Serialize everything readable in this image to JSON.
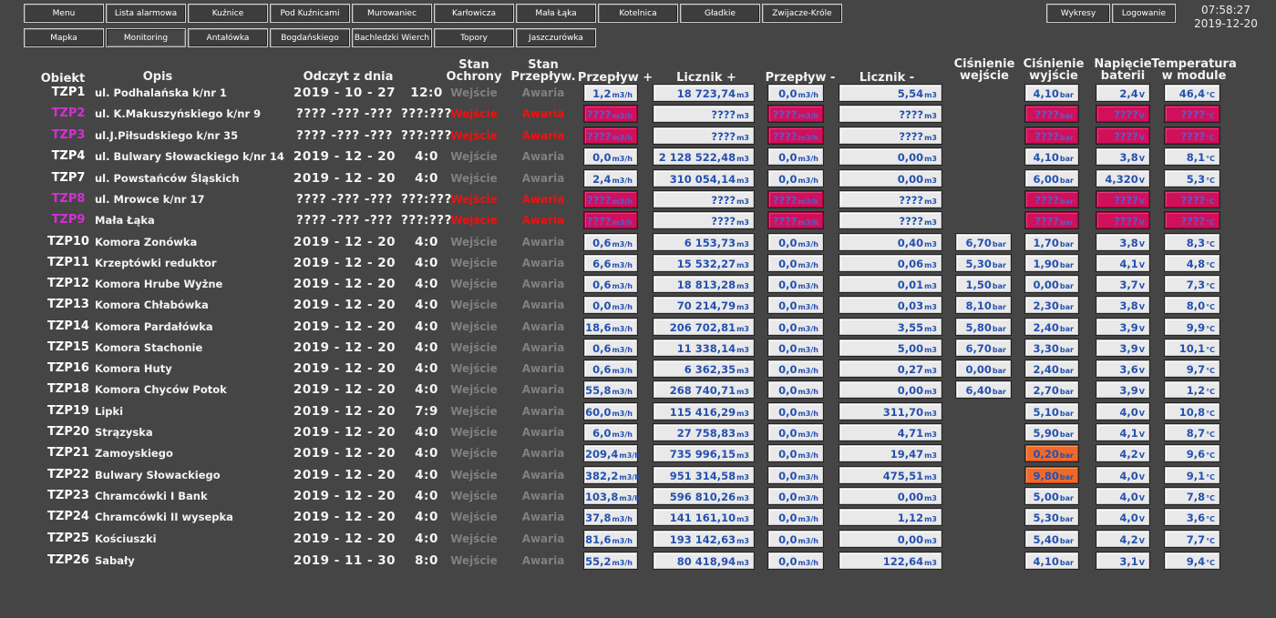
{
  "nav": {
    "row1": [
      "Menu",
      "Lista alarmowa",
      "Kuźnice",
      "Pod Kuźnicami",
      "Murowaniec",
      "Karłowicza",
      "Mała Łąka",
      "Kotelnica",
      "Gładkie",
      "Zwijacze-Króle"
    ],
    "row2": [
      "Mapka",
      "Monitoring",
      "Antałówka",
      "Bogdańskiego",
      "Bachledzki Wierch",
      "Topory",
      "Jaszczurówka"
    ],
    "active": "Monitoring"
  },
  "right_buttons": [
    "Wykresy",
    "Logowanie"
  ],
  "clock": {
    "time": "07:58:27",
    "date": "2019-12-20"
  },
  "headers": {
    "obiekt": "Obiekt",
    "opis": "Opis",
    "odczyt": "Odczyt z dnia",
    "stan_ochrony_1": "Stan",
    "stan_ochrony_2": "Ochrony",
    "stan_przeplyw_1": "Stan",
    "stan_przeplyw_2": "Przepływ.",
    "przeplyw_plus": "Przepływ +",
    "licznik_plus": "Licznik +",
    "przeplyw_minus": "Przepływ -",
    "licznik_minus": "Licznik -",
    "cisn_wej_1": "Ciśnienie",
    "cisn_wej_2": "wejście",
    "cisn_wyj_1": "Ciśnienie",
    "cisn_wyj_2": "wyjście",
    "napiecie_1": "Napięcie",
    "napiecie_2": "baterii",
    "temp_1": "Temperatura",
    "temp_2": "w module"
  },
  "labels": {
    "wejscie": "Wejście",
    "awaria": "Awaria"
  },
  "units": {
    "flow": "m3/h",
    "vol": "m3",
    "bar": "bar",
    "volt": "V",
    "temp": "°C"
  },
  "colors": {
    "alarm_box": "#d0105a",
    "warn_box": "#ef6a2a",
    "alarm_text": "#f01010",
    "alarm_id": "#d430d4",
    "value": "#2451b0"
  },
  "rows": [
    {
      "id": "TZP1",
      "desc": "ul. Podhalańska k/nr 1",
      "date": "2019 - 10 - 27",
      "time": "12:0",
      "alarm": false,
      "f1": "1,2",
      "l1": "18 723,74",
      "f2": "0,0",
      "l2": "5,54",
      "pin": "",
      "pout": "4,10",
      "bat": "2,4",
      "tmp": "46,4"
    },
    {
      "id": "TZP2",
      "desc": "ul. K.Makuszyńskiego k/nr 9",
      "date": "???? -??? -???",
      "time": "???:???",
      "alarm": true,
      "f1": "????",
      "l1": "????",
      "f2": "????",
      "l2": "????",
      "pin": "",
      "pout": "????",
      "bat": "????",
      "tmp": "????"
    },
    {
      "id": "TZP3",
      "desc": "ul.J.Piłsudskiego k/nr 35",
      "date": "???? -??? -???",
      "time": "???:???",
      "alarm": true,
      "f1": "????",
      "l1": "????",
      "f2": "????",
      "l2": "????",
      "pin": "",
      "pout": "????",
      "bat": "????",
      "tmp": "????"
    },
    {
      "id": "TZP4",
      "desc": "ul. Bulwary Słowackiego k/nr 14",
      "date": "2019 - 12 - 20",
      "time": "4:0",
      "alarm": false,
      "f1": "0,0",
      "l1": "2 128 522,48",
      "f2": "0,0",
      "l2": "0,00",
      "pin": "",
      "pout": "4,10",
      "bat": "3,8",
      "tmp": "8,1"
    },
    {
      "id": "TZP7",
      "desc": "ul. Powstańców Śląskich",
      "date": "2019 - 12 - 20",
      "time": "4:0",
      "alarm": false,
      "f1": "2,4",
      "l1": "310 054,14",
      "f2": "0,0",
      "l2": "0,00",
      "pin": "",
      "pout": "6,00",
      "bat": "4,320",
      "tmp": "5,3"
    },
    {
      "id": "TZP8",
      "desc": "ul. Mrowce k/nr 17",
      "date": "???? -??? -???",
      "time": "???:???",
      "alarm": true,
      "f1": "????",
      "l1": "????",
      "f2": "????",
      "l2": "????",
      "pin": "",
      "pout": "????",
      "bat": "????",
      "tmp": "????"
    },
    {
      "id": "TZP9",
      "desc": "Mała Łąka",
      "date": "???? -??? -???",
      "time": "???:???",
      "alarm": true,
      "f1": "????",
      "l1": "????",
      "f2": "????",
      "l2": "????",
      "pin": "",
      "pout": "????",
      "bat": "????",
      "tmp": "????"
    },
    {
      "id": "TZP10",
      "desc": "Komora Zonówka",
      "date": "2019 - 12 - 20",
      "time": "4:0",
      "alarm": false,
      "f1": "0,6",
      "l1": "6 153,73",
      "f2": "0,0",
      "l2": "0,40",
      "pin": "6,70",
      "pout": "1,70",
      "bat": "3,8",
      "tmp": "8,3"
    },
    {
      "id": "TZP11",
      "desc": "Krzeptówki reduktor",
      "date": "2019 - 12 - 20",
      "time": "4:0",
      "alarm": false,
      "f1": "6,6",
      "l1": "15 532,27",
      "f2": "0,0",
      "l2": "0,06",
      "pin": "5,30",
      "pout": "1,90",
      "bat": "4,1",
      "tmp": "4,8"
    },
    {
      "id": "TZP12",
      "desc": "Komora Hrube Wyżne",
      "date": "2019 - 12 - 20",
      "time": "4:0",
      "alarm": false,
      "f1": "0,6",
      "l1": "18 813,28",
      "f2": "0,0",
      "l2": "0,01",
      "pin": "1,50",
      "pout": "0,00",
      "bat": "3,7",
      "tmp": "7,3"
    },
    {
      "id": "TZP13",
      "desc": "Komora Chłabówka",
      "date": "2019 - 12 - 20",
      "time": "4:0",
      "alarm": false,
      "f1": "0,0",
      "l1": "70 214,79",
      "f2": "0,0",
      "l2": "0,03",
      "pin": "8,10",
      "pout": "2,30",
      "bat": "3,8",
      "tmp": "8,0"
    },
    {
      "id": "TZP14",
      "desc": "Komora Pardałówka",
      "date": "2019 - 12 - 20",
      "time": "4:0",
      "alarm": false,
      "f1": "18,6",
      "l1": "206 702,81",
      "f2": "0,0",
      "l2": "3,55",
      "pin": "5,80",
      "pout": "2,40",
      "bat": "3,9",
      "tmp": "9,9"
    },
    {
      "id": "TZP15",
      "desc": "Komora Stachonie",
      "date": "2019 - 12 - 20",
      "time": "4:0",
      "alarm": false,
      "f1": "0,6",
      "l1": "11 338,14",
      "f2": "0,0",
      "l2": "5,00",
      "pin": "6,70",
      "pout": "3,30",
      "bat": "3,9",
      "tmp": "10,1"
    },
    {
      "id": "TZP16",
      "desc": "Komora Huty",
      "date": "2019 - 12 - 20",
      "time": "4:0",
      "alarm": false,
      "f1": "0,6",
      "l1": "6 362,35",
      "f2": "0,0",
      "l2": "0,27",
      "pin": "0,00",
      "pout": "2,40",
      "bat": "3,6",
      "tmp": "9,7"
    },
    {
      "id": "TZP18",
      "desc": "Komora Chyców Potok",
      "date": "2019 - 12 - 20",
      "time": "4:0",
      "alarm": false,
      "f1": "55,8",
      "l1": "268 740,71",
      "f2": "0,0",
      "l2": "0,00",
      "pin": "6,40",
      "pout": "2,70",
      "bat": "3,9",
      "tmp": "1,2"
    },
    {
      "id": "TZP19",
      "desc": "Lipki",
      "date": "2019 - 12 - 20",
      "time": "7:9",
      "alarm": false,
      "f1": "60,0",
      "l1": "115 416,29",
      "f2": "0,0",
      "l2": "311,70",
      "pin": "",
      "pout": "5,10",
      "bat": "4,0",
      "tmp": "10,8"
    },
    {
      "id": "TZP20",
      "desc": "Strązyska",
      "date": "2019 - 12 - 20",
      "time": "4:0",
      "alarm": false,
      "f1": "6,0",
      "l1": "27 758,83",
      "f2": "0,0",
      "l2": "4,71",
      "pin": "",
      "pout": "5,90",
      "bat": "4,1",
      "tmp": "8,7"
    },
    {
      "id": "TZP21",
      "desc": "Zamoyskiego",
      "date": "2019 - 12 - 20",
      "time": "4:0",
      "alarm": false,
      "f1": "209,4",
      "l1": "735 996,15",
      "f2": "0,0",
      "l2": "19,47",
      "pin": "",
      "pout": "0,20",
      "pout_warn": true,
      "bat": "4,2",
      "tmp": "9,6"
    },
    {
      "id": "TZP22",
      "desc": "Bulwary Słowackiego",
      "date": "2019 - 12 - 20",
      "time": "4:0",
      "alarm": false,
      "f1": "382,2",
      "l1": "951 314,58",
      "f2": "0,0",
      "l2": "475,51",
      "pin": "",
      "pout": "9,80",
      "pout_warn": true,
      "bat": "4,0",
      "tmp": "9,1"
    },
    {
      "id": "TZP23",
      "desc": "Chramcówki I Bank",
      "date": "2019 - 12 - 20",
      "time": "4:0",
      "alarm": false,
      "f1": "103,8",
      "l1": "596 810,26",
      "f2": "0,0",
      "l2": "0,00",
      "pin": "",
      "pout": "5,00",
      "bat": "4,0",
      "tmp": "7,8"
    },
    {
      "id": "TZP24",
      "desc": "Chramcówki II wysepka",
      "date": "2019 - 12 - 20",
      "time": "4:0",
      "alarm": false,
      "f1": "37,8",
      "l1": "141 161,10",
      "f2": "0,0",
      "l2": "1,12",
      "pin": "",
      "pout": "5,30",
      "bat": "4,0",
      "tmp": "3,6"
    },
    {
      "id": "TZP25",
      "desc": "Kościuszki",
      "date": "2019 - 12 - 20",
      "time": "4:0",
      "alarm": false,
      "f1": "81,6",
      "l1": "193 142,63",
      "f2": "0,0",
      "l2": "0,00",
      "pin": "",
      "pout": "5,40",
      "bat": "4,2",
      "tmp": "7,7"
    },
    {
      "id": "TZP26",
      "desc": "Sabały",
      "date": "2019 - 11 - 30",
      "time": "8:0",
      "alarm": false,
      "f1": "55,2",
      "l1": "80 418,94",
      "f2": "0,0",
      "l2": "122,64",
      "pin": "",
      "pout": "4,10",
      "bat": "3,1",
      "tmp": "9,4"
    }
  ]
}
